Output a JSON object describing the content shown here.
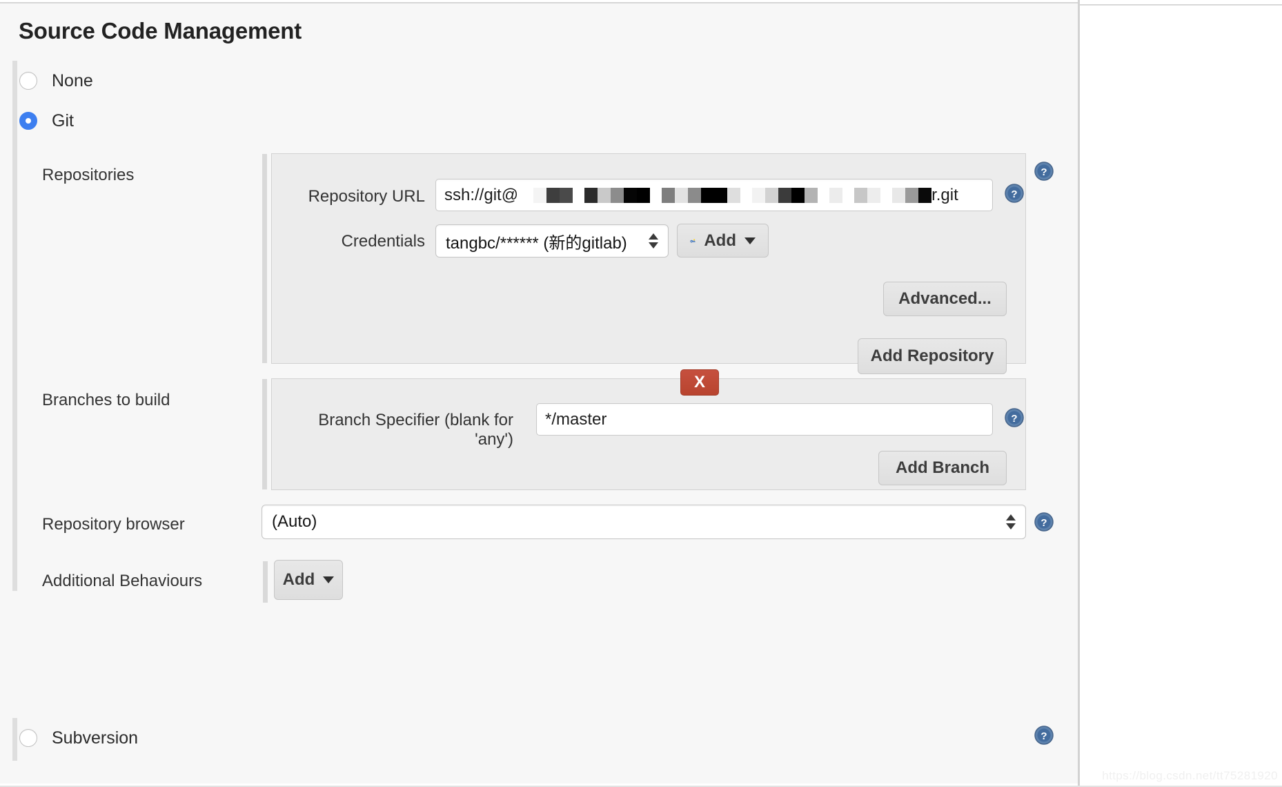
{
  "page": {
    "title": "Source Code Management",
    "watermark": "https://blog.csdn.net/tt75281920"
  },
  "scm_options": [
    {
      "label": "None",
      "selected": false
    },
    {
      "label": "Git",
      "selected": true
    },
    {
      "label": "Subversion",
      "selected": false
    }
  ],
  "git": {
    "repositories": {
      "label": "Repositories",
      "repository_url": {
        "label": "Repository URL",
        "value_prefix": "ssh://git@",
        "value_suffix": "r.git",
        "redacted": true
      },
      "credentials": {
        "label": "Credentials",
        "value": "tangbc/****** (新的gitlab)",
        "add_button": "Add",
        "add_icon": "key-icon"
      },
      "advanced_button": "Advanced...",
      "add_repository_button": "Add Repository"
    },
    "branches": {
      "label": "Branches to build",
      "branch_specifier": {
        "label": "Branch Specifier (blank for 'any')",
        "value": "*/master"
      },
      "delete_button": "X",
      "add_branch_button": "Add Branch"
    },
    "repository_browser": {
      "label": "Repository browser",
      "value": "(Auto)"
    },
    "additional_behaviours": {
      "label": "Additional Behaviours",
      "add_button": "Add"
    }
  },
  "colors": {
    "accent": "#3d7ff0",
    "danger": "#b8442f",
    "help": "#3f6ea8",
    "panel": "#ececec",
    "canvas": "#f7f7f7"
  },
  "icons": {
    "help": "help-icon",
    "caret": "chevron-down-icon",
    "select_arrows": "stepper-arrows-icon"
  }
}
